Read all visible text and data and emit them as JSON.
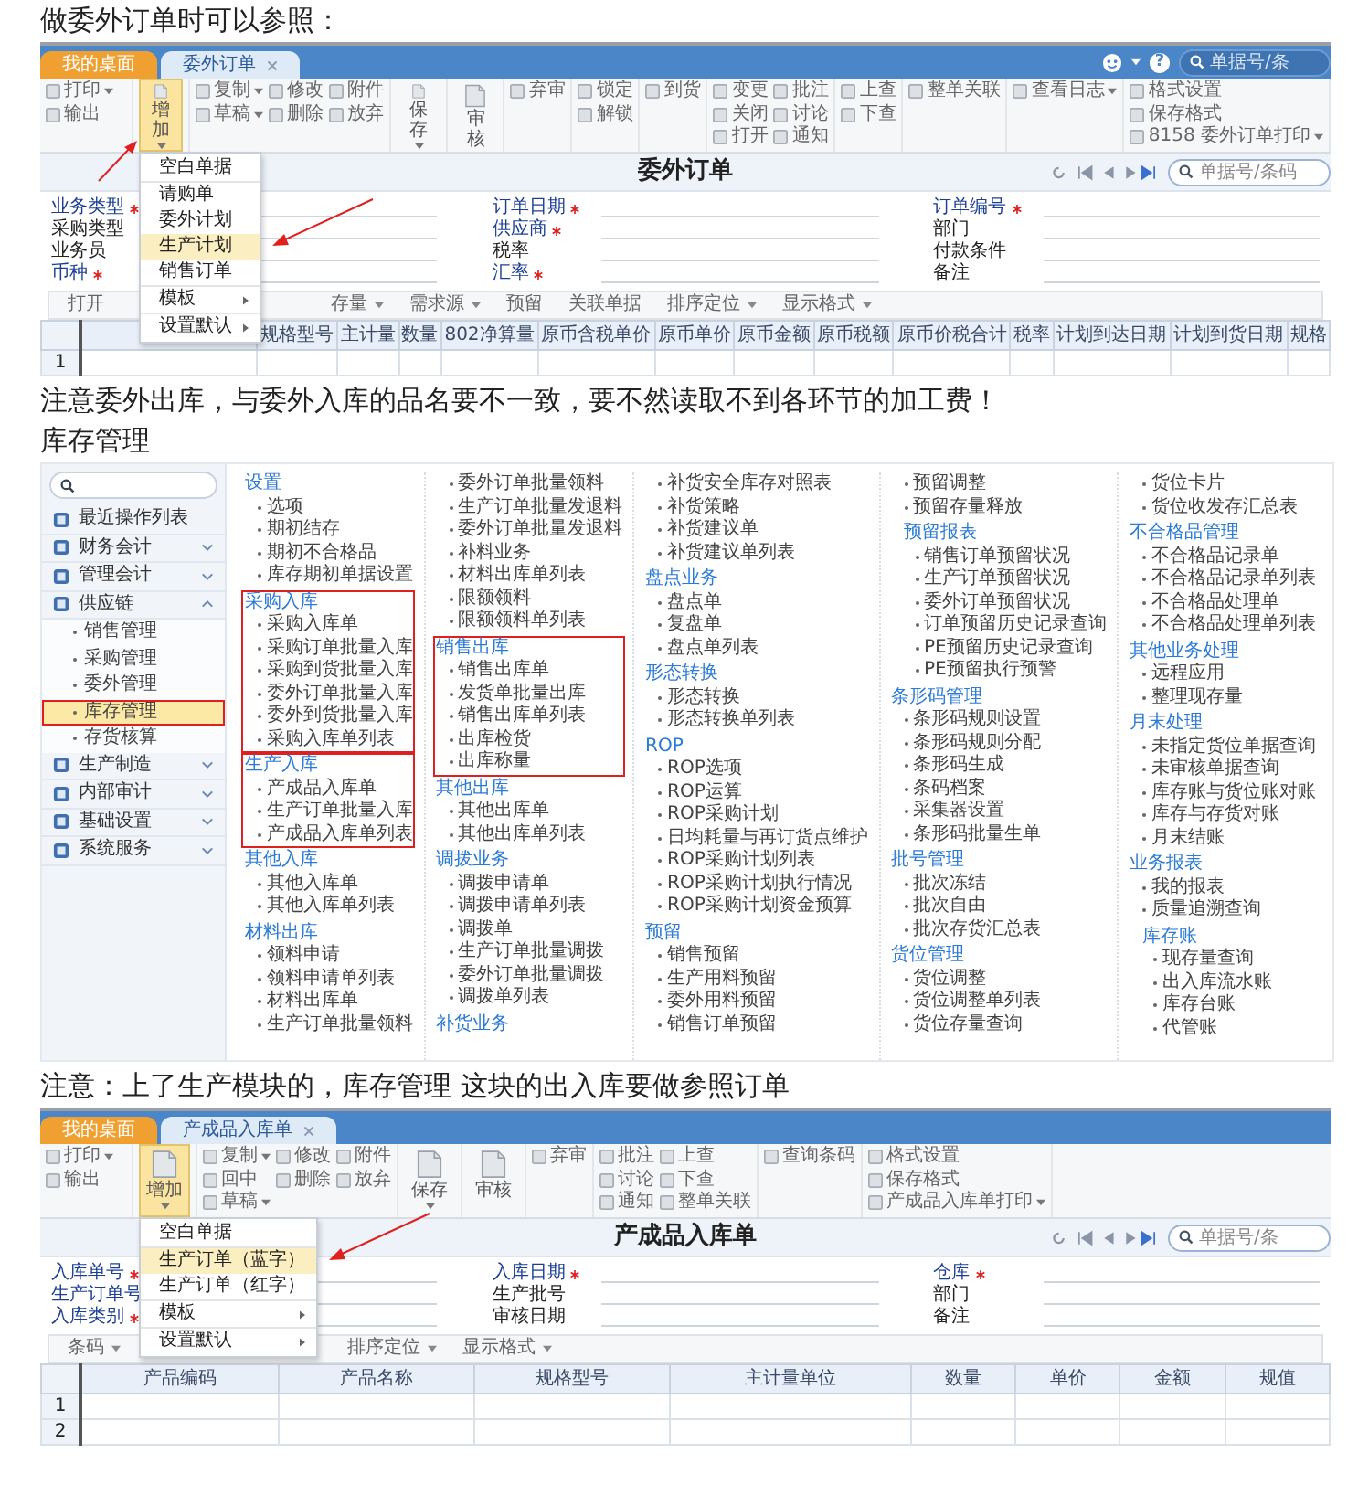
{
  "blocks": [
    {
      "kind": "text",
      "text": "做委外订单时可以参照："
    },
    {
      "kind": "form_screen",
      "tabs": [
        {
          "label": "我的桌面",
          "selected": false
        },
        {
          "label": "委外订单",
          "selected": true,
          "closable": true
        }
      ],
      "header": {
        "help": "?",
        "search": {
          "placeholder": "单据号/条"
        }
      },
      "toolbar": [
        {
          "kind": "small",
          "columns": [
            [
              {
                "label": "打印",
                "caret": true
              },
              {
                "label": "输出",
                "caret": false
              }
            ]
          ]
        },
        {
          "kind": "big",
          "label": "增加",
          "caret": true,
          "pressed": true,
          "arrow": true,
          "menu": [
            {
              "label": "空白单据",
              "selected": false
            },
            {
              "label": "请购单",
              "selected": false,
              "divider": true
            },
            {
              "label": "委外计划",
              "selected": false
            },
            {
              "label": "生产计划",
              "selected": true,
              "arrow": true
            },
            {
              "label": "销售订单",
              "selected": false
            },
            {
              "label": "模板",
              "selected": false,
              "submenu": true,
              "divider": true
            },
            {
              "label": "设置默认",
              "selected": false,
              "submenu": true,
              "divider": true
            }
          ]
        },
        {
          "kind": "small",
          "columns": [
            [
              {
                "label": "复制",
                "caret": true
              },
              {
                "label": "草稿",
                "caret": true
              }
            ],
            [
              {
                "label": "修改",
                "caret": false
              },
              {
                "label": "删除",
                "caret": false
              }
            ],
            [
              {
                "label": "附件",
                "caret": false
              },
              {
                "label": "放弃",
                "caret": false
              }
            ]
          ]
        },
        {
          "kind": "big",
          "label": "保存",
          "caret": true,
          "pressed": false
        },
        {
          "kind": "big",
          "label": "审核",
          "caret": false,
          "pressed": false
        },
        {
          "kind": "small",
          "columns": [
            [
              {
                "label": "弃审",
                "caret": false
              }
            ]
          ]
        },
        {
          "kind": "small",
          "columns": [
            [
              {
                "label": "锁定",
                "caret": false
              },
              {
                "label": "解锁",
                "caret": false
              }
            ]
          ]
        },
        {
          "kind": "small",
          "columns": [
            [
              {
                "label": "到货",
                "caret": false
              }
            ]
          ]
        },
        {
          "kind": "small",
          "columns": [
            [
              {
                "label": "变更",
                "caret": false
              },
              {
                "label": "关闭",
                "caret": false
              },
              {
                "label": "打开",
                "caret": false
              }
            ],
            [
              {
                "label": "批注",
                "caret": false
              },
              {
                "label": "讨论",
                "caret": false
              },
              {
                "label": "通知",
                "caret": false
              }
            ]
          ]
        },
        {
          "kind": "small",
          "columns": [
            [
              {
                "label": "上查",
                "caret": false
              },
              {
                "label": "下查",
                "caret": false
              }
            ]
          ]
        },
        {
          "kind": "small",
          "columns": [
            [
              {
                "label": "整单关联",
                "caret": false
              }
            ]
          ]
        },
        {
          "kind": "small",
          "columns": [
            [
              {
                "label": "查看日志",
                "caret": true
              }
            ]
          ]
        },
        {
          "kind": "small",
          "columns": [
            [
              {
                "label": "格式设置",
                "caret": false
              },
              {
                "label": "保存格式",
                "caret": false
              },
              {
                "label": "8158 委外订单打印",
                "caret": true
              }
            ]
          ]
        }
      ],
      "title": "委外订单",
      "title_search": {
        "placeholder": "单据号/条码"
      },
      "fields": [
        [
          {
            "label": "业务类型",
            "link": true,
            "required": true
          },
          {
            "label": "采购类型"
          },
          {
            "label": "业务员"
          },
          {
            "label": "币种",
            "link": true,
            "required": true
          }
        ],
        [
          {
            "label": "订单日期",
            "link": true,
            "required": true
          },
          {
            "label": "供应商",
            "link": true,
            "required": true
          },
          {
            "label": "税率"
          },
          {
            "label": "汇率",
            "link": true,
            "required": true
          }
        ],
        [
          {
            "label": "订单编号",
            "link": true,
            "required": true
          },
          {
            "label": "部门"
          },
          {
            "label": "付款条件"
          },
          {
            "label": "备注"
          }
        ]
      ],
      "grid_toolbar": [
        {
          "label": "打开",
          "caret": false
        },
        {
          "label": "存量",
          "caret": true
        },
        {
          "label": "需求源",
          "caret": true
        },
        {
          "label": "预留",
          "caret": false
        },
        {
          "label": "关联单据",
          "caret": false
        },
        {
          "label": "排序定位",
          "caret": true
        },
        {
          "label": "显示格式",
          "caret": true
        }
      ],
      "table": {
        "covered": true,
        "columns": [
          "规格型号",
          "主计量",
          "数量",
          "802净算量",
          "原币含税单价",
          "原币单价",
          "原币金额",
          "原币税额",
          "原币价税合计",
          "税率",
          "计划到达日期",
          "计划到货日期",
          "规格"
        ],
        "rows": [
          "1"
        ]
      }
    },
    {
      "kind": "text",
      "text": "注意委外出库，与委外入库的品名要不一致，要不然读取不到各环节的加工费！"
    },
    {
      "kind": "text",
      "text": "库存管理"
    },
    {
      "kind": "menu_screen",
      "sidebar": [
        {
          "label": "最近操作列表"
        },
        {
          "label": "财务会计",
          "expanded": false
        },
        {
          "label": "管理会计",
          "expanded": false
        },
        {
          "label": "供应链",
          "expanded": true,
          "children": [
            {
              "label": "销售管理",
              "selected": false
            },
            {
              "label": "采购管理",
              "selected": false
            },
            {
              "label": "委外管理",
              "selected": false
            },
            {
              "label": "库存管理",
              "selected": true,
              "highlighted": true
            },
            {
              "label": "存货核算",
              "selected": false
            }
          ]
        },
        {
          "label": "生产制造",
          "expanded": false
        },
        {
          "label": "内部审计",
          "expanded": false
        },
        {
          "label": "基础设置",
          "expanded": false
        },
        {
          "label": "系统服务",
          "expanded": false
        }
      ],
      "columns": [
        [
          {
            "heading": "设置",
            "items": [
              "选项",
              "期初结存",
              "期初不合格品",
              "库存期初单据设置"
            ]
          },
          {
            "heading": "采购入库",
            "highlighted": true,
            "items": [
              "采购入库单",
              "采购订单批量入库",
              "采购到货批量入库",
              "委外订单批量入库",
              "委外到货批量入库",
              "采购入库单列表"
            ]
          },
          {
            "heading": "生产入库",
            "highlighted": true,
            "items": [
              "产成品入库单",
              "生产订单批量入库",
              "产成品入库单列表"
            ]
          },
          {
            "heading": "其他入库",
            "items": [
              "其他入库单",
              "其他入库单列表"
            ]
          },
          {
            "heading": "材料出库",
            "items": [
              "领料申请",
              "领料申请单列表",
              "材料出库单",
              "生产订单批量领料"
            ]
          }
        ],
        [
          {
            "items": [
              "委外订单批量领料",
              "生产订单批量发退料",
              "委外订单批量发退料",
              "补料业务",
              "材料出库单列表",
              "限额领料",
              "限额领料单列表"
            ]
          },
          {
            "heading": "销售出库",
            "highlighted": true,
            "items": [
              "销售出库单",
              "发货单批量出库",
              "销售出库单列表",
              "出库检货",
              "出库称量"
            ]
          },
          {
            "heading": "其他出库",
            "items": [
              "其他出库单",
              "其他出库单列表"
            ]
          },
          {
            "heading": "调拨业务",
            "items": [
              "调拨申请单",
              "调拨申请单列表",
              "调拨单",
              "生产订单批量调拨",
              "委外订单批量调拨",
              "调拨单列表"
            ]
          },
          {
            "heading": "补货业务"
          }
        ],
        [
          {
            "items": [
              "补货安全库存对照表",
              "补货策略",
              "补货建议单",
              "补货建议单列表"
            ]
          },
          {
            "heading": "盘点业务",
            "items": [
              "盘点单",
              "复盘单",
              "盘点单列表"
            ]
          },
          {
            "heading": "形态转换",
            "items": [
              "形态转换",
              "形态转换单列表"
            ]
          },
          {
            "heading": "ROP",
            "items": [
              "ROP选项",
              "ROP运算",
              "ROP采购计划",
              "日均耗量与再订货点维护",
              "ROP采购计划列表",
              "ROP采购计划执行情况",
              "ROP采购计划资金预算"
            ]
          },
          {
            "heading": "预留",
            "items": [
              "销售预留",
              "生产用料预留",
              "委外用料预留",
              "销售订单预留"
            ]
          }
        ],
        [
          {
            "items": [
              "预留调整",
              "预留存量释放"
            ]
          },
          {
            "heading": "预留报表",
            "indented": true,
            "items": [
              "销售订单预留状况",
              "生产订单预留状况",
              "委外订单预留状况",
              "订单预留历史记录查询",
              "PE预留历史记录查询",
              "PE预留执行预警"
            ]
          },
          {
            "heading": "条形码管理",
            "items": [
              "条形码规则设置",
              "条形码规则分配",
              "条形码生成",
              "条码档案",
              "采集器设置",
              "条形码批量生单"
            ]
          },
          {
            "heading": "批号管理",
            "items": [
              "批次冻结",
              "批次自由",
              "批次存货汇总表"
            ]
          },
          {
            "heading": "货位管理",
            "items": [
              "货位调整",
              "货位调整单列表",
              "货位存量查询"
            ]
          }
        ],
        [
          {
            "items": [
              "货位卡片",
              "货位收发存汇总表"
            ]
          },
          {
            "heading": "不合格品管理",
            "items": [
              "不合格品记录单",
              "不合格品记录单列表",
              "不合格品处理单",
              "不合格品处理单列表"
            ]
          },
          {
            "heading": "其他业务处理",
            "items": [
              "远程应用",
              "整理现存量"
            ]
          },
          {
            "heading": "月末处理",
            "items": [
              "未指定货位单据查询",
              "未审核单据查询",
              "库存账与货位账对账",
              "库存与存货对账",
              "月末结账"
            ]
          },
          {
            "heading": "业务报表",
            "items": [
              "我的报表",
              "质量追溯查询"
            ]
          },
          {
            "heading": "库存账",
            "indented": true,
            "items": [
              "现存量查询",
              "出入库流水账",
              "库存台账",
              "代管账"
            ]
          }
        ]
      ]
    },
    {
      "kind": "text",
      "text": "注意：上了生产模块的，库存管理 这块的出入库要做参照订单"
    },
    {
      "kind": "form_screen",
      "tabs": [
        {
          "label": "我的桌面",
          "selected": false
        },
        {
          "label": "产成品入库单",
          "selected": true,
          "closable": true
        }
      ],
      "toolbar": [
        {
          "kind": "small",
          "columns": [
            [
              {
                "label": "打印",
                "caret": true
              },
              {
                "label": "输出",
                "caret": false
              }
            ]
          ]
        },
        {
          "kind": "big",
          "label": "增加",
          "caret": true,
          "pressed": true,
          "menu": [
            {
              "label": "空白单据",
              "selected": false
            },
            {
              "label": "生产订单（蓝字）",
              "selected": true,
              "divider": true,
              "arrow": true
            },
            {
              "label": "生产订单（红字）",
              "selected": false
            },
            {
              "label": "模板",
              "selected": false,
              "submenu": true,
              "divider": true
            },
            {
              "label": "设置默认",
              "selected": false,
              "submenu": true,
              "divider": true
            }
          ]
        },
        {
          "kind": "small",
          "columns": [
            [
              {
                "label": "复制",
                "caret": true
              },
              {
                "label": "回中",
                "caret": false
              },
              {
                "label": "草稿",
                "caret": true
              }
            ],
            [
              {
                "label": "修改",
                "caret": false
              },
              {
                "label": "删除",
                "caret": false
              }
            ],
            [
              {
                "label": "附件",
                "caret": false
              },
              {
                "label": "放弃",
                "caret": false
              }
            ]
          ]
        },
        {
          "kind": "big",
          "label": "保存",
          "caret": true,
          "pressed": false
        },
        {
          "kind": "big",
          "label": "审核",
          "caret": false,
          "pressed": false
        },
        {
          "kind": "small",
          "columns": [
            [
              {
                "label": "弃审",
                "caret": false
              }
            ]
          ]
        },
        {
          "kind": "small",
          "columns": [
            [
              {
                "label": "批注",
                "caret": false
              },
              {
                "label": "讨论",
                "caret": false
              },
              {
                "label": "通知",
                "caret": false
              }
            ],
            [
              {
                "label": "上查",
                "caret": false
              },
              {
                "label": "下查",
                "caret": false
              },
              {
                "label": "整单关联",
                "caret": false
              }
            ]
          ]
        },
        {
          "kind": "small",
          "columns": [
            [
              {
                "label": "查询条码",
                "caret": false
              }
            ]
          ]
        },
        {
          "kind": "small",
          "columns": [
            [
              {
                "label": "格式设置",
                "caret": false
              },
              {
                "label": "保存格式",
                "caret": false
              },
              {
                "label": "产成品入库单打印",
                "caret": true
              }
            ]
          ]
        }
      ],
      "title": "产成品入库单",
      "title_search": {
        "placeholder": "单据号/条"
      },
      "fields": [
        [
          {
            "label": "入库单号",
            "link": true,
            "required": true
          },
          {
            "label": "生产订单号",
            "link": true
          },
          {
            "label": "入库类别",
            "link": true,
            "required": true
          }
        ],
        [
          {
            "label": "入库日期",
            "link": true,
            "required": true
          },
          {
            "label": "生产批号"
          },
          {
            "label": "审核日期"
          }
        ],
        [
          {
            "label": "仓库",
            "link": true,
            "required": true
          },
          {
            "label": "部门"
          },
          {
            "label": "备注"
          }
        ]
      ],
      "grid_toolbar": [
        {
          "label": "条码",
          "caret": true
        },
        {
          "label": "排序定位",
          "caret": true
        },
        {
          "label": "显示格式",
          "caret": true
        }
      ],
      "table": {
        "columns": [
          "产品编码",
          "产品名称",
          "规格型号",
          "主计量单位",
          "数量",
          "单价",
          "金额",
          "规值"
        ],
        "rows": [
          "1",
          "2"
        ]
      }
    }
  ]
}
